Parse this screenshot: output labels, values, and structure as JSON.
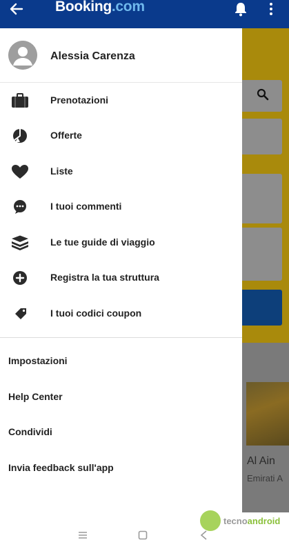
{
  "app_bar": {
    "brand_main": "Booking",
    "brand_suffix": ".com",
    "icons": [
      "back-arrow-icon",
      "bell-icon",
      "more-vert-icon"
    ]
  },
  "drawer": {
    "user_name": "Alessia Carenza",
    "menu_items": [
      {
        "label": "Prenotazioni",
        "icon": "briefcase-icon"
      },
      {
        "label": "Offerte",
        "icon": "offers-icon"
      },
      {
        "label": "Liste",
        "icon": "heart-icon"
      },
      {
        "label": "I tuoi commenti",
        "icon": "comment-icon"
      },
      {
        "label": "Le tue guide di viaggio",
        "icon": "guides-icon"
      },
      {
        "label": "Registra la tua struttura",
        "icon": "add-circle-icon"
      },
      {
        "label": "I tuoi codici coupon",
        "icon": "tag-icon"
      }
    ],
    "settings_items": [
      {
        "label": "Impostazioni"
      },
      {
        "label": "Help Center"
      },
      {
        "label": "Condividi"
      },
      {
        "label": "Invia feedback sull'app"
      }
    ]
  },
  "background": {
    "city": "Al Ain",
    "country": "Emirati A"
  },
  "watermark": {
    "part1": "tecno",
    "part2": "android"
  },
  "colors": {
    "app_bar": "#0a3a8c",
    "brand_accent": "#6fb8ec"
  }
}
